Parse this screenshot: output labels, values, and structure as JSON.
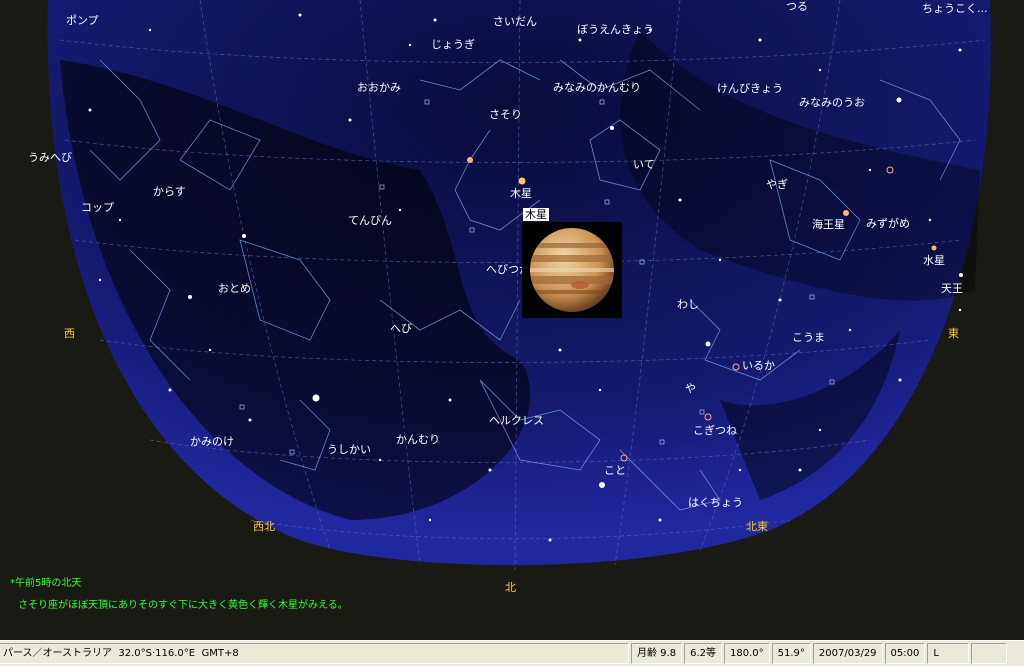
{
  "constellations": [
    {
      "id": "ponpu",
      "text": "ポンプ"
    },
    {
      "id": "tsuru",
      "text": "つる"
    },
    {
      "id": "chokokushitsu",
      "text": "ちょうこく..."
    },
    {
      "id": "saidan",
      "text": "さいだん"
    },
    {
      "id": "jogi",
      "text": "じょうぎ"
    },
    {
      "id": "boenkyo",
      "text": "ぼうえんきょう"
    },
    {
      "id": "ookami",
      "text": "おおかみ"
    },
    {
      "id": "minaminokanmuri",
      "text": "みなみのかんむり"
    },
    {
      "id": "kenbikyo",
      "text": "けんびきょう"
    },
    {
      "id": "minaminouo",
      "text": "みなみのうお"
    },
    {
      "id": "sasori",
      "text": "さそり"
    },
    {
      "id": "umihebi",
      "text": "うみへび"
    },
    {
      "id": "ite",
      "text": "いて"
    },
    {
      "id": "karasu",
      "text": "からす"
    },
    {
      "id": "yagi",
      "text": "やぎ"
    },
    {
      "id": "koppu",
      "text": "コップ"
    },
    {
      "id": "mizugame",
      "text": "みずがめ"
    },
    {
      "id": "tenbin",
      "text": "てんびん"
    },
    {
      "id": "hebitsukai",
      "text": "へびつかい"
    },
    {
      "id": "otome",
      "text": "おとめ"
    },
    {
      "id": "washi",
      "text": "わし"
    },
    {
      "id": "hebi",
      "text": "へび"
    },
    {
      "id": "kouma",
      "text": "こうま"
    },
    {
      "id": "iruka",
      "text": "いるか"
    },
    {
      "id": "ya",
      "text": "や"
    },
    {
      "id": "herukuresu",
      "text": "ヘルクレス"
    },
    {
      "id": "kogitsune",
      "text": "こぎつね"
    },
    {
      "id": "kaminoke",
      "text": "かみのけ"
    },
    {
      "id": "kanmuri",
      "text": "かんむり"
    },
    {
      "id": "ushikai",
      "text": "うしかい"
    },
    {
      "id": "koto",
      "text": "こと"
    },
    {
      "id": "hakucho",
      "text": "はくちょう"
    }
  ],
  "planets": {
    "jupiter": "木星",
    "jupiter_highlight": "木星",
    "neptune": "海王星",
    "mercury": "水星",
    "uranus": "天王"
  },
  "directions": {
    "west": "西",
    "east": "東",
    "northwest": "西北",
    "northeast": "北東",
    "north": "北"
  },
  "notes": {
    "title": "*午前5時の北天",
    "body": "さそり座がほぼ天頂にありそのすぐ下に大きく黄色く輝く木星がみえる。"
  },
  "status": {
    "location": "パース／オーストラリア",
    "coords": "32.0°S·116.0°E",
    "timezone": "GMT+8",
    "moon_age": "月齢 9.8",
    "magnitude": "6.2等",
    "azimuth": "180.0°",
    "altitude": "51.9°",
    "date": "2007/03/29",
    "time": "05:00",
    "mode": "L"
  },
  "colors": {
    "sky": "#16186a",
    "label": "#ffffff",
    "direction": "#ffcc33",
    "note": "#33ff33",
    "status_bg": "#ece9d8"
  }
}
